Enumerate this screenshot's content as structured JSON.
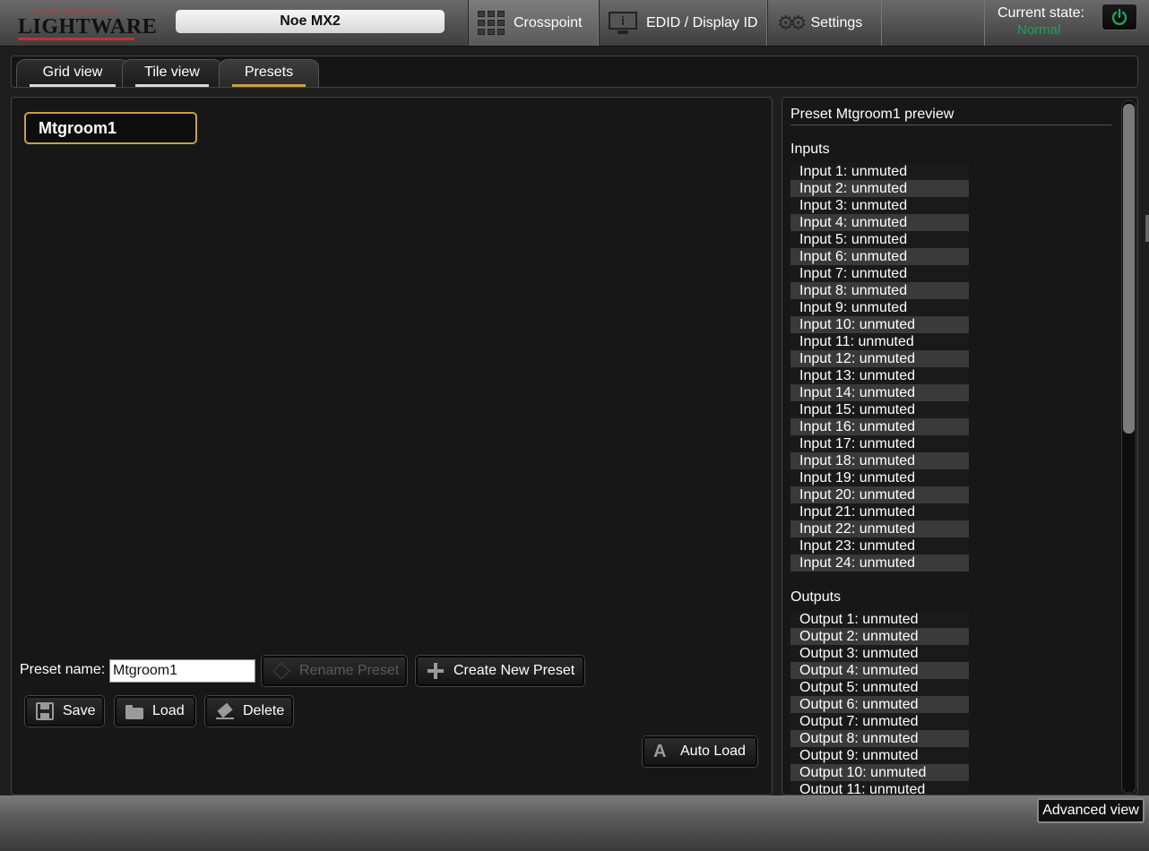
{
  "header": {
    "logo_tagline": "visual engineering",
    "logo_name": "LIGHTWARE",
    "device_name": "Noe MX2",
    "nav": {
      "crosspoint": "Crosspoint",
      "edid": "EDID / Display ID",
      "settings": "Settings"
    },
    "state_label": "Current state:",
    "state_value": "Normal",
    "state_color": "#1fa35b"
  },
  "subtabs": {
    "grid": "Grid view",
    "tile": "Tile view",
    "presets": "Presets",
    "active": "Presets"
  },
  "presets": {
    "items": [
      "Mtgroom1"
    ],
    "selected": "Mtgroom1",
    "name_label": "Preset name:",
    "name_value": "Mtgroom1",
    "rename_label": "Rename Preset",
    "create_label": "Create New Preset",
    "save_label": "Save",
    "load_label": "Load",
    "delete_label": "Delete",
    "autoload_label": "Auto Load"
  },
  "preview": {
    "title": "Preset Mtgroom1 preview",
    "inputs_heading": "Inputs",
    "inputs": [
      "Input 1: unmuted",
      "Input 2: unmuted",
      "Input 3: unmuted",
      "Input 4: unmuted",
      "Input 5: unmuted",
      "Input 6: unmuted",
      "Input 7: unmuted",
      "Input 8: unmuted",
      "Input 9: unmuted",
      "Input 10: unmuted",
      "Input 11: unmuted",
      "Input 12: unmuted",
      "Input 13: unmuted",
      "Input 14: unmuted",
      "Input 15: unmuted",
      "Input 16: unmuted",
      "Input 17: unmuted",
      "Input 18: unmuted",
      "Input 19: unmuted",
      "Input 20: unmuted",
      "Input 21: unmuted",
      "Input 22: unmuted",
      "Input 23: unmuted",
      "Input 24: unmuted"
    ],
    "outputs_heading": "Outputs",
    "outputs": [
      "Output 1: unmuted",
      "Output 2: unmuted",
      "Output 3: unmuted",
      "Output 4: unmuted",
      "Output 5: unmuted",
      "Output 6: unmuted",
      "Output 7: unmuted",
      "Output 8: unmuted",
      "Output 9: unmuted",
      "Output 10: unmuted",
      "Output 11: unmuted"
    ]
  },
  "footer": {
    "advanced_label": "Advanced view"
  },
  "colors": {
    "accent": "#c8a040",
    "brand_red": "#c9302c"
  }
}
